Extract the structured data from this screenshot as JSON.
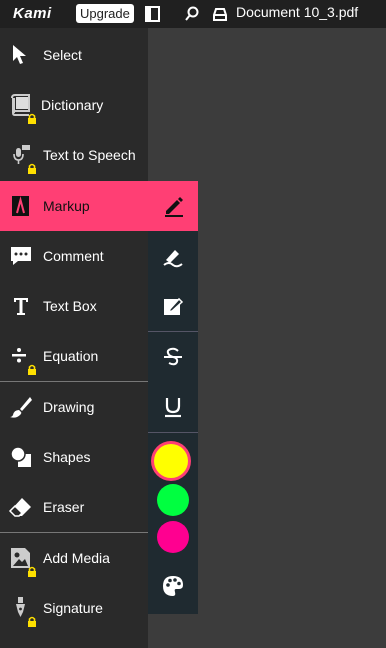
{
  "topbar": {
    "logo": "Kami",
    "upgrade_label": "Upgrade",
    "document_title": "Document 10_3.pdf"
  },
  "tools": [
    {
      "id": "select",
      "label": "Select",
      "locked": false
    },
    {
      "id": "dictionary",
      "label": "Dictionary",
      "locked": true
    },
    {
      "id": "text-to-speech",
      "label": "Text to Speech",
      "locked": true
    },
    {
      "id": "markup",
      "label": "Markup",
      "locked": false,
      "active": true
    },
    {
      "id": "comment",
      "label": "Comment",
      "locked": false
    },
    {
      "id": "text-box",
      "label": "Text Box",
      "locked": false
    },
    {
      "id": "equation",
      "label": "Equation",
      "locked": true
    },
    {
      "id": "drawing",
      "label": "Drawing",
      "locked": false
    },
    {
      "id": "shapes",
      "label": "Shapes",
      "locked": false
    },
    {
      "id": "eraser",
      "label": "Eraser",
      "locked": false
    },
    {
      "id": "add-media",
      "label": "Add Media",
      "locked": true
    },
    {
      "id": "signature",
      "label": "Signature",
      "locked": true
    }
  ],
  "markup_panel": {
    "sub_tools": [
      "highlight",
      "note-pencil",
      "strikethrough",
      "underline"
    ],
    "colors": [
      "#ffff00",
      "#00ff40",
      "#ff0090"
    ],
    "selected_color": "#ffff00"
  },
  "colors": {
    "accent": "#ff3f74",
    "lock": "#ffe000",
    "sidebar": "#2a2a2a",
    "canvas": "#3c3c3c"
  }
}
